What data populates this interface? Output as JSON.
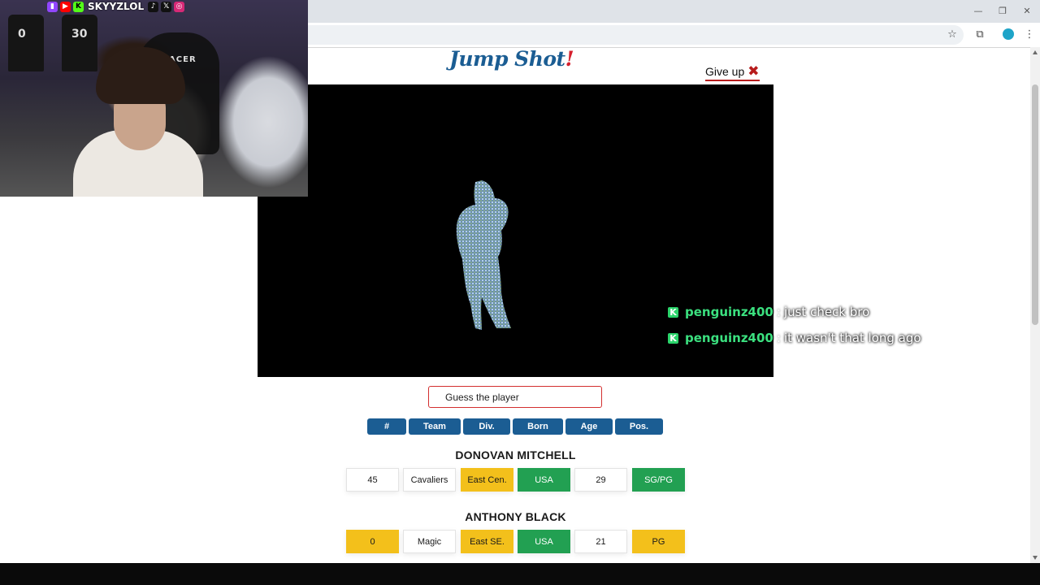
{
  "colors": {
    "brand_blue": "#1b5d93",
    "accent_red": "#d61f2c",
    "match_green": "#22a052",
    "partial_yellow": "#f3c01b",
    "chat_user_green": "#3be07f"
  },
  "webcam": {
    "handle": "SKYYZLOL",
    "chair_brand": "G-RACER",
    "jersey_numbers": [
      "0",
      "30"
    ],
    "social_icons": [
      "twitch-icon",
      "youtube-icon",
      "kick-icon",
      "tiktok-icon",
      "x-icon",
      "instagram-icon"
    ]
  },
  "page": {
    "brand_main": "Jump Shot",
    "brand_bang": "!",
    "give_up_label": "Give up",
    "guess_placeholder": "Guess the player",
    "columns": [
      "#",
      "Team",
      "Div.",
      "Born",
      "Age",
      "Pos."
    ]
  },
  "chat": [
    {
      "user": "penguinz400",
      "message": "just check bro"
    },
    {
      "user": "penguinz400",
      "message": "it wasn't that long ago"
    }
  ],
  "players": [
    {
      "name": "DONOVAN MITCHELL",
      "cells": [
        {
          "value": "45",
          "status": "none"
        },
        {
          "value": "Cavaliers",
          "status": "none"
        },
        {
          "value": "East Cen.",
          "status": "partial"
        },
        {
          "value": "USA",
          "status": "match"
        },
        {
          "value": "29",
          "status": "none"
        },
        {
          "value": "SG/PG",
          "status": "match"
        }
      ]
    },
    {
      "name": "ANTHONY BLACK",
      "cells": [
        {
          "value": "0",
          "status": "partial"
        },
        {
          "value": "Magic",
          "status": "none"
        },
        {
          "value": "East SE.",
          "status": "partial"
        },
        {
          "value": "USA",
          "status": "match"
        },
        {
          "value": "21",
          "status": "none"
        },
        {
          "value": "PG",
          "status": "partial"
        }
      ]
    }
  ]
}
